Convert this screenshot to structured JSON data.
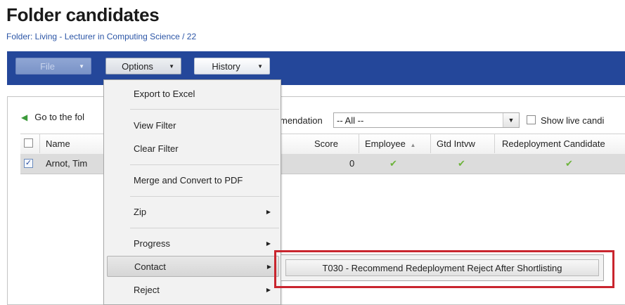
{
  "header": {
    "title": "Folder candidates",
    "subtitle": "Folder: Living - Lecturer in Computing Science / 22"
  },
  "toolbar": {
    "file_label": "File",
    "options_label": "Options",
    "history_label": "History"
  },
  "panel": {
    "pager_text": "Go to the fol",
    "filter_label": "mendation",
    "filter_value": "-- All --",
    "show_live_label": "Show live candi"
  },
  "table": {
    "columns": [
      "Name",
      "Score",
      "Employee",
      "Gtd Intvw",
      "Redeployment Candidate"
    ],
    "rows": [
      {
        "checked": true,
        "name": "Arnot, Tim",
        "score": "0",
        "employee": true,
        "gtd_intvw": true,
        "redeployment": true
      }
    ]
  },
  "options_menu": {
    "items": [
      {
        "label": "Export to Excel",
        "submenu": false
      },
      {
        "label": "View Filter",
        "submenu": false
      },
      {
        "label": "Clear Filter",
        "submenu": false
      },
      {
        "label": "Merge and Convert to PDF",
        "submenu": false
      },
      {
        "label": "Zip",
        "submenu": true
      },
      {
        "label": "Progress",
        "submenu": true
      },
      {
        "label": "Contact",
        "submenu": true,
        "highlighted": true
      },
      {
        "label": "Reject",
        "submenu": true
      }
    ]
  },
  "contact_submenu": {
    "items": [
      "T030 - Recommend Redeployment Reject After Shortlisting"
    ]
  },
  "colors": {
    "toolbar": "#24479a",
    "subtitle": "#2b55a6",
    "highlight_box": "#c9252e",
    "check_green": "#6cb33a"
  }
}
